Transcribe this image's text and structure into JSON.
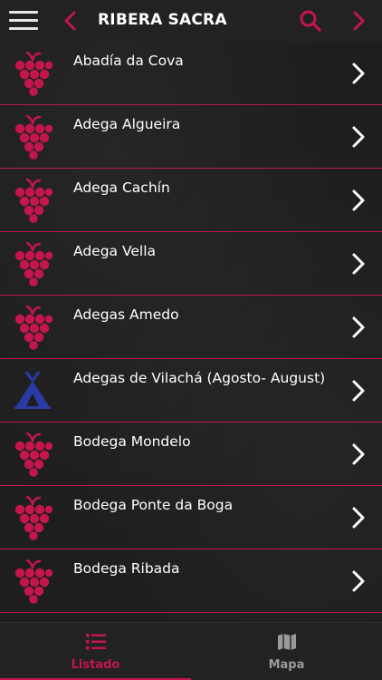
{
  "header": {
    "title": "RIBERA SACRA",
    "icons": [
      "menu-icon",
      "back-arrow-icon",
      "search-icon",
      "forward-arrow-icon"
    ]
  },
  "colors": {
    "accent": "#c4164d",
    "grape": "#c4164d",
    "camping": "#2a3aa6",
    "background": "#1e1e1e",
    "bar": "#222222"
  },
  "list": {
    "items": [
      {
        "label": "Abadía da Cova",
        "icon": "grape-icon"
      },
      {
        "label": "Adega Algueira",
        "icon": "grape-icon"
      },
      {
        "label": "Adega Cachín",
        "icon": "grape-icon"
      },
      {
        "label": "Adega Vella",
        "icon": "grape-icon"
      },
      {
        "label": "Adegas Amedo",
        "icon": "grape-icon"
      },
      {
        "label": "Adegas de Vilachá (Agosto- August)",
        "icon": "tent-icon"
      },
      {
        "label": "Bodega Mondelo",
        "icon": "grape-icon"
      },
      {
        "label": "Bodega Ponte da Boga",
        "icon": "grape-icon"
      },
      {
        "label": "Bodega Ribada",
        "icon": "grape-icon"
      }
    ]
  },
  "tabbar": {
    "tabs": [
      {
        "label": "Listado",
        "icon": "list-icon",
        "active": true
      },
      {
        "label": "Mapa",
        "icon": "map-icon",
        "active": false
      }
    ]
  }
}
